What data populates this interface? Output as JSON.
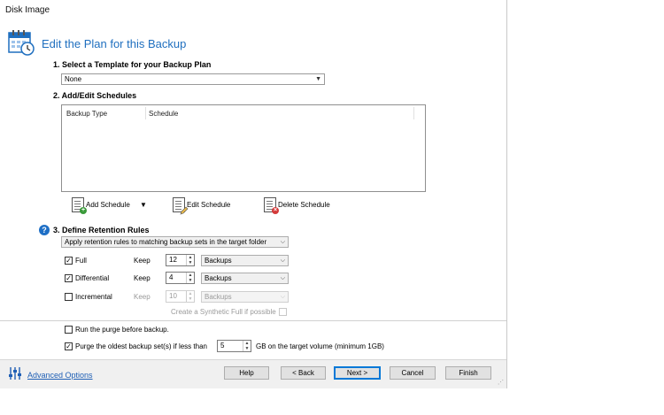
{
  "window": {
    "title": "Disk Image"
  },
  "header": {
    "title": "Edit the Plan for this Backup",
    "icon": "calendar-clock-icon"
  },
  "template": {
    "heading": "1. Select a Template for your Backup Plan",
    "selected": "None"
  },
  "schedules": {
    "heading": "2. Add/Edit Schedules",
    "columns": [
      "Backup Type",
      "Schedule"
    ],
    "add_label": "Add Schedule",
    "edit_label": "Edit Schedule",
    "delete_label": "Delete Schedule"
  },
  "retention": {
    "heading": "3. Define Retention Rules",
    "rule_option": "Apply retention rules to matching backup sets in the target folder",
    "rows": [
      {
        "label": "Full",
        "checked": true,
        "keep": "Keep",
        "count": "12",
        "unit": "Backups",
        "enabled": true
      },
      {
        "label": "Differential",
        "checked": true,
        "keep": "Keep",
        "count": "4",
        "unit": "Backups",
        "enabled": true
      },
      {
        "label": "Incremental",
        "checked": false,
        "keep": "Keep",
        "count": "10",
        "unit": "Backups",
        "enabled": false
      }
    ],
    "synthetic_label": "Create a Synthetic Full if possible"
  },
  "purge": {
    "run_before_label": "Run the purge before backup.",
    "oldest_label": "Purge the oldest backup set(s) if less than",
    "oldest_value": "5",
    "oldest_suffix": "GB on the target volume (minimum 1GB)"
  },
  "footer": {
    "advanced_label": "Advanced Options",
    "help": "Help",
    "back": "< Back",
    "next": "Next >",
    "cancel": "Cancel",
    "finish": "Finish"
  },
  "colors": {
    "accent": "#1f6fbf",
    "link": "#1f5fb5",
    "primary_border": "#0078d7"
  }
}
